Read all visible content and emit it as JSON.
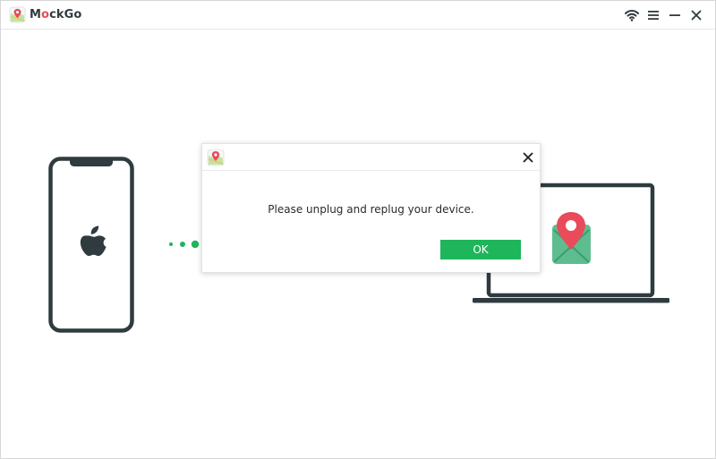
{
  "app": {
    "name_prefix": "M",
    "name_o": "o",
    "name_suffix": "ckGo",
    "logo_icon": "map-pin-logo-icon"
  },
  "window_controls": {
    "icons": [
      "wifi-icon",
      "menu-icon",
      "minimize-icon",
      "close-icon"
    ]
  },
  "illustration": {
    "phone_icon": "iphone-apple-icon",
    "connection_icon": "connection-dots-icon",
    "laptop_icon": "laptop-location-icon"
  },
  "dialog": {
    "message": "Please unplug and replug your device.",
    "ok_label": "OK",
    "close_icon": "close-icon"
  },
  "colors": {
    "accent_green": "#1fb55b",
    "pin_red": "#e94b5b",
    "map_green": "#5ebd8f",
    "dark_outline": "#2f3b3f"
  }
}
